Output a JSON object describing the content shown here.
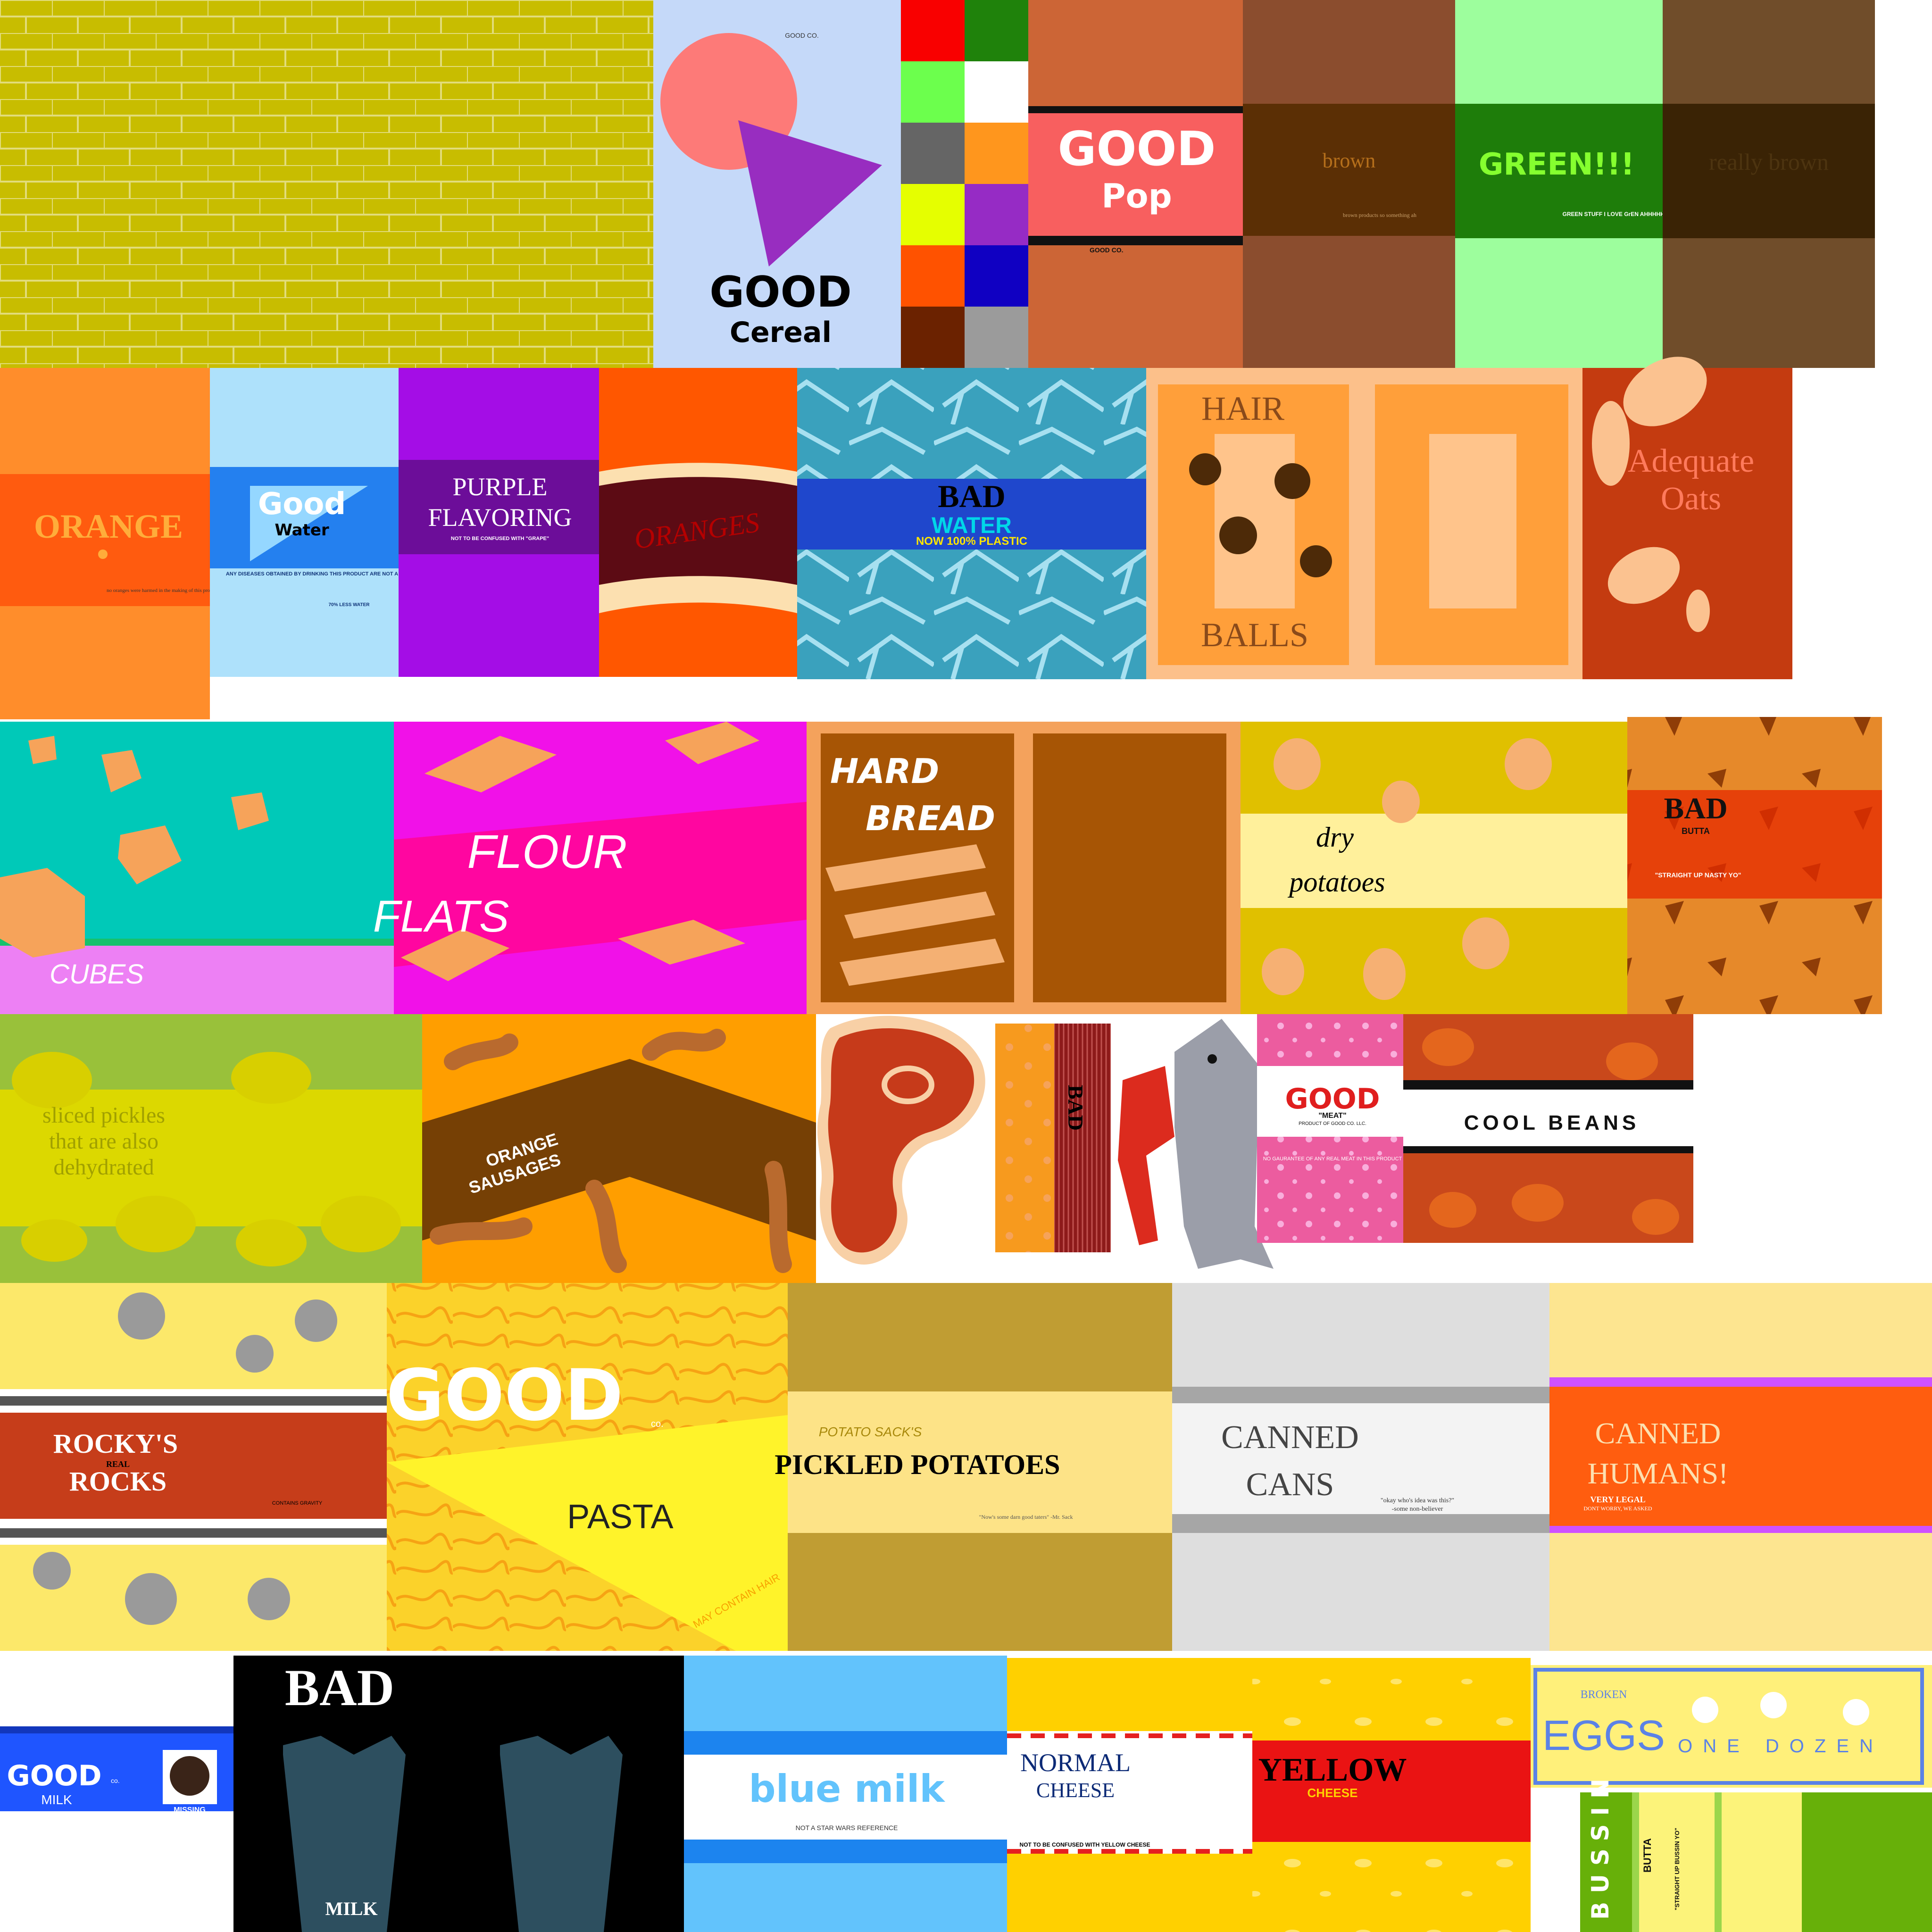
{
  "labels": {
    "good_cereal": {
      "title": "GOOD",
      "subtitle": "Cereal",
      "brand": "GOOD CO."
    },
    "good_pop": {
      "title": "GOOD",
      "subtitle": "Pop",
      "brand": "GOOD CO."
    },
    "brown": {
      "title": "brown",
      "note": "brown products so something ah"
    },
    "green": {
      "title": "GREEN!!!",
      "note": "GREEN STUFF I LOVE GrEN AHHHHHH"
    },
    "really_brown": {
      "title": "really brown"
    },
    "orange": {
      "title": "ORANGE",
      "note": "no oranges were harmed in the making of this product"
    },
    "good_water": {
      "title": "Good",
      "subtitle": "Water",
      "note": "ANY DISEASES OBTAINED BY DRINKING THIS PRODUCT ARE NOT A LIABILITY OF GOOD CO.,LLC",
      "footer": "70% LESS WATER"
    },
    "purple_flavoring": {
      "title_1": "PURPLE",
      "title_2": "FLAVORING",
      "note": "NOT TO BE CONFUSED WITH \"GRAPE\""
    },
    "oranges": {
      "title": "ORANGES"
    },
    "bad_water": {
      "title": "BAD",
      "subtitle": "WATER",
      "tagline": "NOW 100% PLASTIC"
    },
    "hair_balls": {
      "title_1": "HAIR",
      "title_2": "BALLS"
    },
    "adequate_oats": {
      "title_1": "Adequate",
      "title_2": "Oats"
    },
    "cubes": {
      "title": "CUBES"
    },
    "flour_flats": {
      "title_1": "FLOUR",
      "title_2": "FLATS"
    },
    "hard_bread": {
      "title_1": "HARD",
      "title_2": "BREAD"
    },
    "dry_potatoes": {
      "title_1": "dry",
      "title_2": "potatoes"
    },
    "bad_butta": {
      "title": "BAD",
      "subtitle": "BUTTA",
      "tagline": "\"STRAIGHT UP NASTY YO\""
    },
    "pickles": {
      "line_1": "sliced pickles",
      "line_2": "that are also",
      "line_3": "dehydrated"
    },
    "orange_sausages": {
      "line_1": "ORANGE",
      "line_2": "SAUSAGES"
    },
    "bad_sausage": {
      "title": "BAD"
    },
    "good_meat": {
      "title": "GOOD",
      "subtitle": "\"MEAT\"",
      "byline": "PRODUCT OF GOOD CO. LLC.",
      "note": "NO GAURANTEE OF ANY REAL MEAT IN THIS PRODUCT"
    },
    "cool_beans": {
      "title": "COOL BEANS"
    },
    "rockys_rocks": {
      "line_1": "ROCKY'S",
      "middle": "REAL",
      "line_2": "ROCKS",
      "note": "CONTAINS GRAVITY"
    },
    "good_pasta": {
      "title": "GOOD",
      "suffix": "co.",
      "subtitle": "PASTA",
      "note": "MAY CONTAIN HAIR"
    },
    "pickled_potatoes": {
      "brand": "POTATO SACK'S",
      "title": "PICKLED POTATOES",
      "quote": "\"Now's some darn good taters\" -Mr. Sack"
    },
    "canned_cans": {
      "line_1": "CANNED",
      "line_2": "CANS",
      "quote": "\"okay who's idea was this?\"",
      "attribution": "-some non-believer"
    },
    "canned_humans": {
      "line_1": "CANNED",
      "line_2": "HUMANS!",
      "legal": "VERY LEGAL",
      "note": "DONT WORRY, WE ASKED"
    },
    "good_milk": {
      "title": "GOOD",
      "suffix": "co.",
      "subtitle": "MILK",
      "missing": "MISSING"
    },
    "bad_milk": {
      "title": "BAD",
      "subtitle": "MILK"
    },
    "blue_milk": {
      "title": "blue milk",
      "note": "NOT A STAR WARS REFERENCE"
    },
    "normal_cheese": {
      "line_1": "NORMAL",
      "line_2": "CHEESE",
      "note": "NOT TO BE CONFUSED WITH YELLOW CHEESE"
    },
    "yellow_cheese": {
      "title": "YELLOW",
      "subtitle": "CHEESE"
    },
    "broken_eggs": {
      "brand": "BROKEN",
      "title": "EGGS",
      "subtitle": "ONE DOZEN"
    },
    "bussin_butta": {
      "title": "BUSSIN",
      "subtitle": "BUTTA",
      "tagline": "\"STRAIGHT UP BUSSIN YO\""
    }
  },
  "colors": {
    "brick": "#c8bd00",
    "cereal_bg": "#c5d9f9",
    "pop": "#f85f5f",
    "brown": "#8b4d2e",
    "green": "#1e7d0a",
    "orange": "#ff8d2b",
    "water": "#aee1fb",
    "purple": "#a40de6",
    "bad_water": "#1f47cc",
    "hair": "#fcc08a",
    "oats": "#c43b10",
    "cubes": "#00c9b8",
    "flour": "#f111e8",
    "bread": "#a75505",
    "potato": "#e0c000",
    "butta": "#e65a08",
    "pickle": "#99c13a",
    "sausage": "#ff9e00",
    "meat_pink": "#ec5c9f",
    "beans": "#c9481b",
    "rocks": "#fce86a",
    "pasta": "#fbd22a",
    "sack": "#c09d33",
    "can": "#dedede",
    "human": "#ff5d0f",
    "milk_blue": "#1f55ff",
    "cheese": "#ffd000",
    "eggs": "#fff07a"
  }
}
